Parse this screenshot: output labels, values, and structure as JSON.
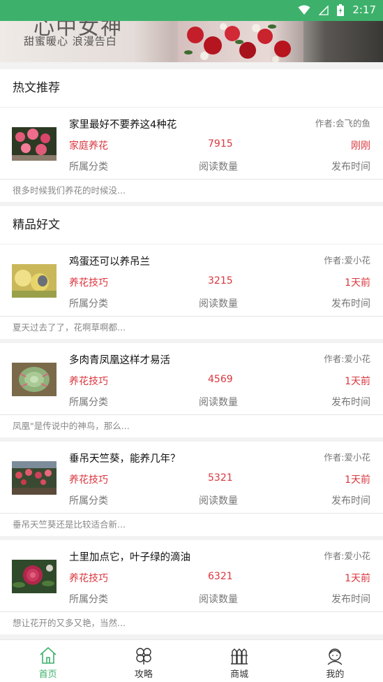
{
  "status_bar": {
    "time": "2:17",
    "icons": [
      "wifi-icon",
      "signal-icon",
      "battery-icon"
    ]
  },
  "banner": {
    "title": "心中女神",
    "subtitle": "甜蜜暖心 浪漫告白"
  },
  "sections": [
    {
      "title": "热文推荐"
    },
    {
      "title": "精品好文"
    }
  ],
  "labels": {
    "category": "所属分类",
    "reads": "阅读数量",
    "published": "发布时间"
  },
  "articles": [
    {
      "title": "家里最好不要养这4种花",
      "author": "作者:会飞的鱼",
      "category": "家庭养花",
      "reads": "7915",
      "time": "刚刚",
      "summary": "很多时候我们养花的时候没..."
    },
    {
      "title": "鸡蛋还可以养吊兰",
      "author": "作者:爱小花",
      "category": "养花技巧",
      "reads": "3215",
      "time": "1天前",
      "summary": "夏天过去了了，花啊草啊都..."
    },
    {
      "title": "多肉青凤凰这样才易活",
      "author": "作者:爱小花",
      "category": "养花技巧",
      "reads": "4569",
      "time": "1天前",
      "summary": "凤凰\"是传说中的神鸟，那么..."
    },
    {
      "title": "垂吊天竺葵，能养几年？",
      "author": "作者:爱小花",
      "category": "养花技巧",
      "reads": "5321",
      "time": "1天前",
      "summary": "垂吊天竺葵还是比较适合新..."
    },
    {
      "title": "土里加点它，叶子绿的滴油",
      "author": "作者:爱小花",
      "category": "养花技巧",
      "reads": "6321",
      "time": "1天前",
      "summary": "想让花开的又多又艳，当然..."
    }
  ],
  "bottom_nav": [
    {
      "label": "首页",
      "icon": "home-icon",
      "active": true
    },
    {
      "label": "攻略",
      "icon": "clover-icon",
      "active": false
    },
    {
      "label": "商城",
      "icon": "store-fence-icon",
      "active": false
    },
    {
      "label": "我的",
      "icon": "profile-icon",
      "active": false
    }
  ],
  "colors": {
    "accent": "#3db16b",
    "highlight": "#d9363e",
    "muted": "#777777"
  }
}
